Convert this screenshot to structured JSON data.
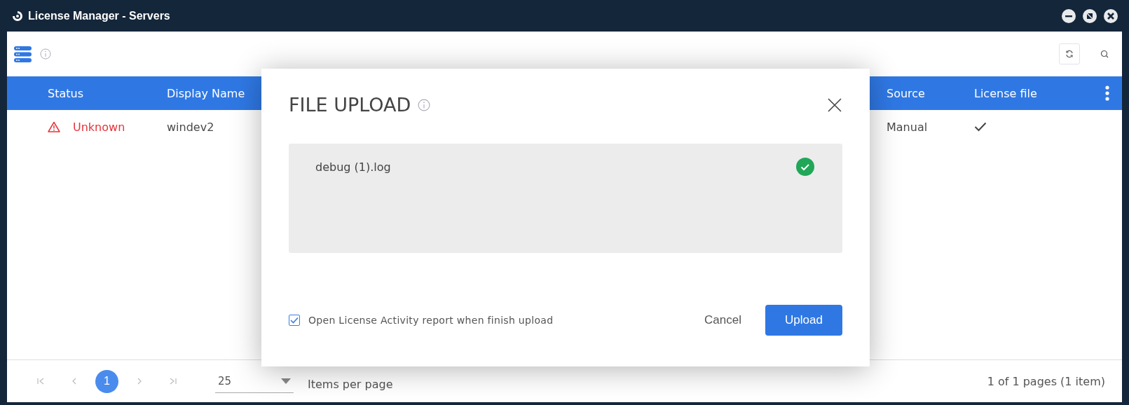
{
  "window": {
    "title": "License Manager - Servers"
  },
  "table": {
    "columns": [
      {
        "label": "Status"
      },
      {
        "label": "Display Name"
      },
      {
        "label": "Source"
      },
      {
        "label": "License file"
      }
    ],
    "rows": [
      {
        "status": "Unknown",
        "display_name": "windev2",
        "source": "Manual",
        "license_file": true
      }
    ]
  },
  "pagination": {
    "pages": [
      {
        "label": "1",
        "selected": true
      }
    ],
    "page_size": "25",
    "page_size_label": "Items per page",
    "summary": "1 of 1 pages (1 item)"
  },
  "dialog": {
    "title": "FILE UPLOAD",
    "files": [
      {
        "name": "debug (1).log",
        "done": true
      }
    ],
    "option": {
      "label": "Open License Activity report when finish upload",
      "checked": true
    },
    "buttons": [
      {
        "label": "Cancel",
        "kind": "text"
      },
      {
        "label": "Upload",
        "kind": "primary"
      }
    ]
  }
}
